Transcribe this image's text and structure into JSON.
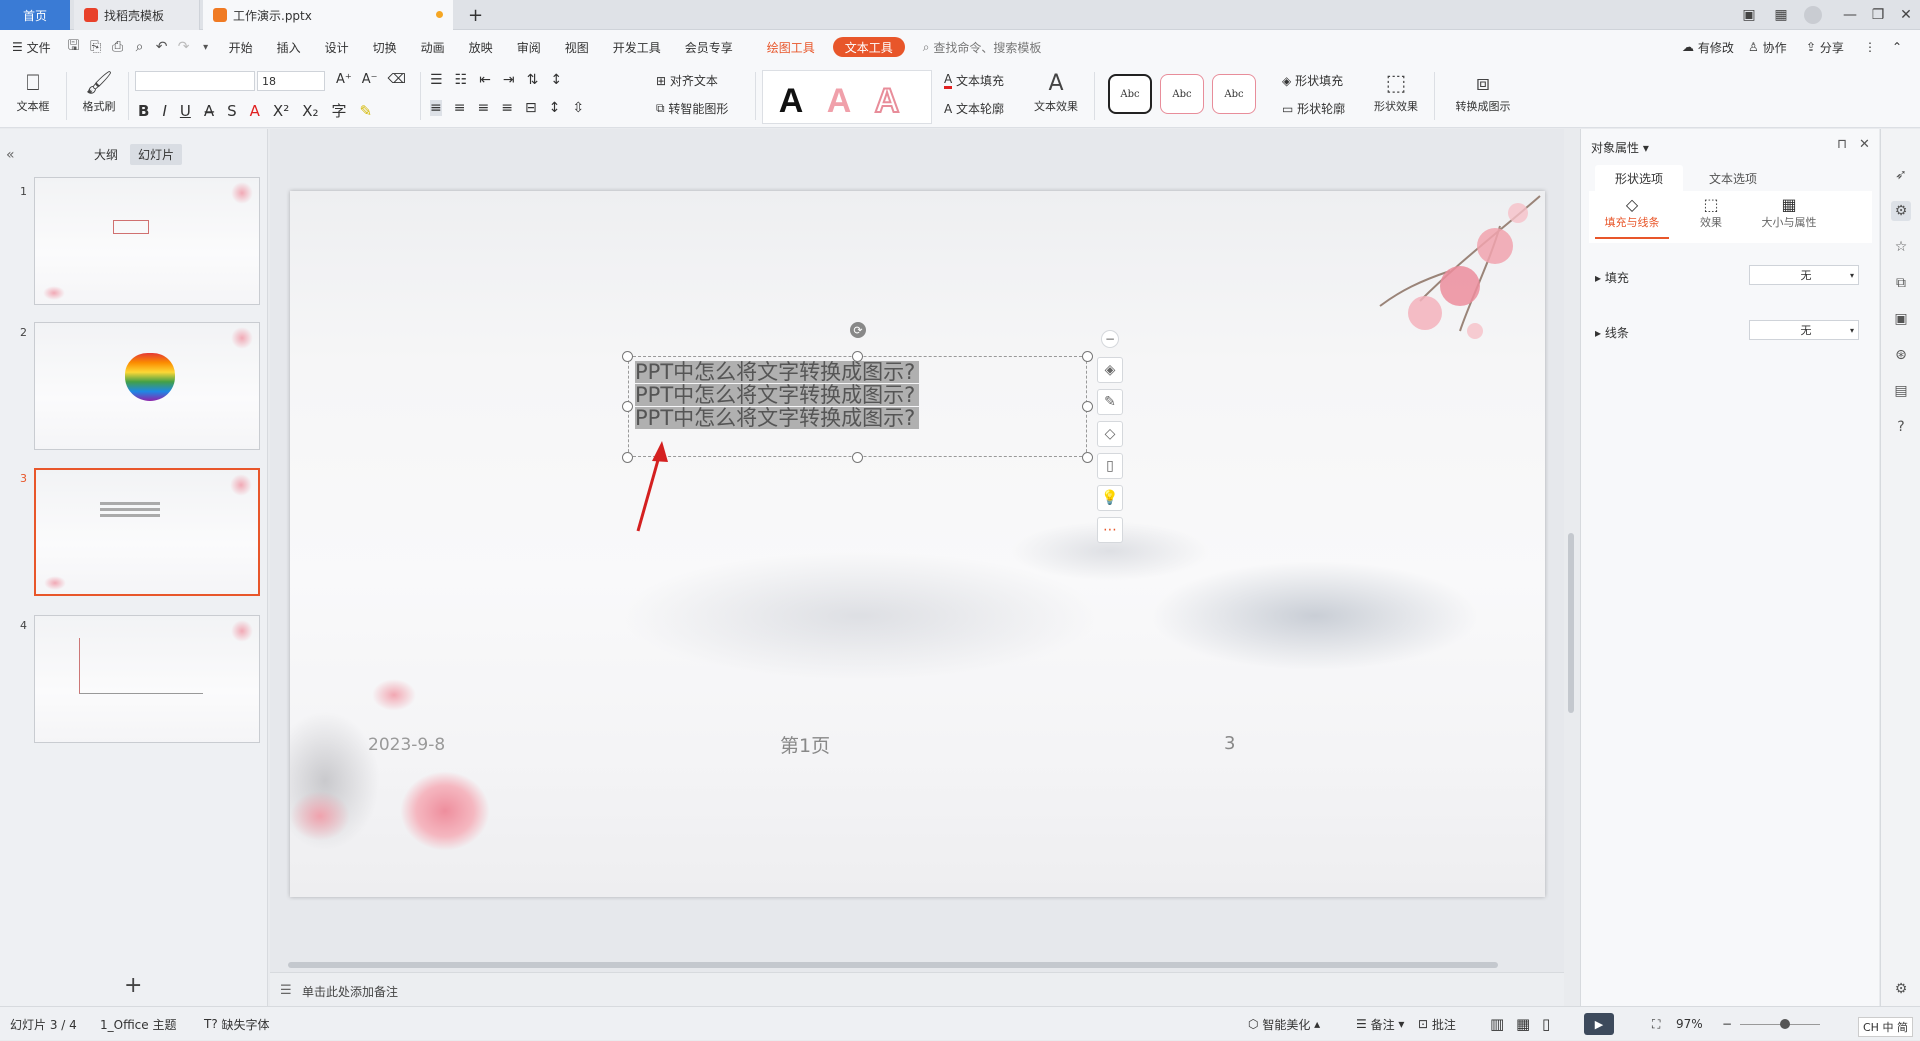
{
  "tabs": {
    "home": "首页",
    "t1": "找稻壳模板",
    "t2": "工作演示.pptx",
    "new": "+"
  },
  "menu": {
    "file": "文件",
    "items": [
      "开始",
      "插入",
      "设计",
      "切换",
      "动画",
      "放映",
      "审阅",
      "视图",
      "开发工具",
      "会员专享"
    ],
    "draw_tool": "绘图工具",
    "text_tool": "文本工具",
    "search": "查找命令、搜索模板",
    "modify": "有修改",
    "collab": "协作",
    "share": "分享"
  },
  "ribbon": {
    "textbox": "文本框",
    "format_painter": "格式刷",
    "font_size": "18",
    "align_text": "对齐文本",
    "smart_shape": "转智能图形",
    "text_fill": "文本填充",
    "text_outline": "文本轮廓",
    "text_effect": "文本效果",
    "shape_fill": "形状填充",
    "shape_outline": "形状轮廓",
    "shape_effect": "形状效果",
    "convert_diagram": "转换成图示",
    "abc": "Abc",
    "bigA": "A"
  },
  "left": {
    "outline": "大纲",
    "slides": "幻灯片",
    "nums": [
      "1",
      "2",
      "3",
      "4"
    ]
  },
  "slide": {
    "lines": [
      "PPT中怎么将文字转换成图示?",
      "PPT中怎么将文字转换成图示?",
      "PPT中怎么将文字转换成图示?"
    ],
    "date": "2023-9-8",
    "page_label": "第1页",
    "page_num": "3"
  },
  "right": {
    "title": "对象属性",
    "tab_shape": "形状选项",
    "tab_text": "文本选项",
    "sub_fill": "填充与线条",
    "sub_effect": "效果",
    "sub_size": "大小与属性",
    "fill_label": "填充",
    "fill_value": "无",
    "line_label": "线条",
    "line_value": "无"
  },
  "notes": {
    "placeholder": "单击此处添加备注"
  },
  "status": {
    "slide": "幻灯片 3 / 4",
    "theme": "1_Office 主题",
    "missing_font": "缺失字体",
    "beautify": "智能美化",
    "notes": "备注",
    "comments": "批注",
    "zoom": "97%",
    "ime": "CH 中 简"
  },
  "colors": {
    "accent": "#e8562a",
    "home_tab": "#3a7bd5"
  }
}
